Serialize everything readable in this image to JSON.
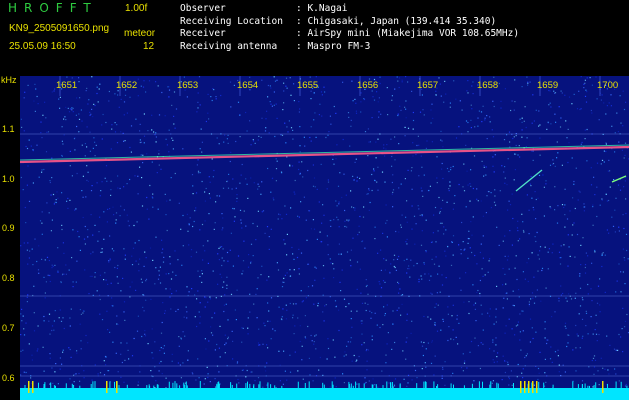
{
  "header": {
    "brand": "HROFFT",
    "version": "1.00f",
    "filename": "KN9_2505091650.png",
    "timestamp": "25.05.09 16:50",
    "meteor_label": "meteor",
    "meteor_count": "12"
  },
  "info": [
    {
      "key": "Observer",
      "value": ": K.Nagai"
    },
    {
      "key": "Receiving Location",
      "value": ": Chigasaki, Japan (139.414 35.340)"
    },
    {
      "key": "Receiver",
      "value": ": AirSpy mini (Miakejima VOR 108.65MHz)"
    },
    {
      "key": "Receiving antenna",
      "value": ": Maspro FM-3"
    }
  ],
  "axis": {
    "y_unit": "kHz",
    "y_ticks": [
      "1.1",
      "1.0",
      "0.9",
      "0.8",
      "0.7",
      "0.6"
    ],
    "x_ticks": [
      "1651",
      "1652",
      "1653",
      "1654",
      "1655",
      "1656",
      "1657",
      "1658",
      "1659",
      "1700"
    ]
  },
  "colors": {
    "background": "#000000",
    "plot_bg": "#06127e",
    "label": "#e8e000",
    "brand": "#2ecc40",
    "noise_floor": "#00e5ff"
  }
}
